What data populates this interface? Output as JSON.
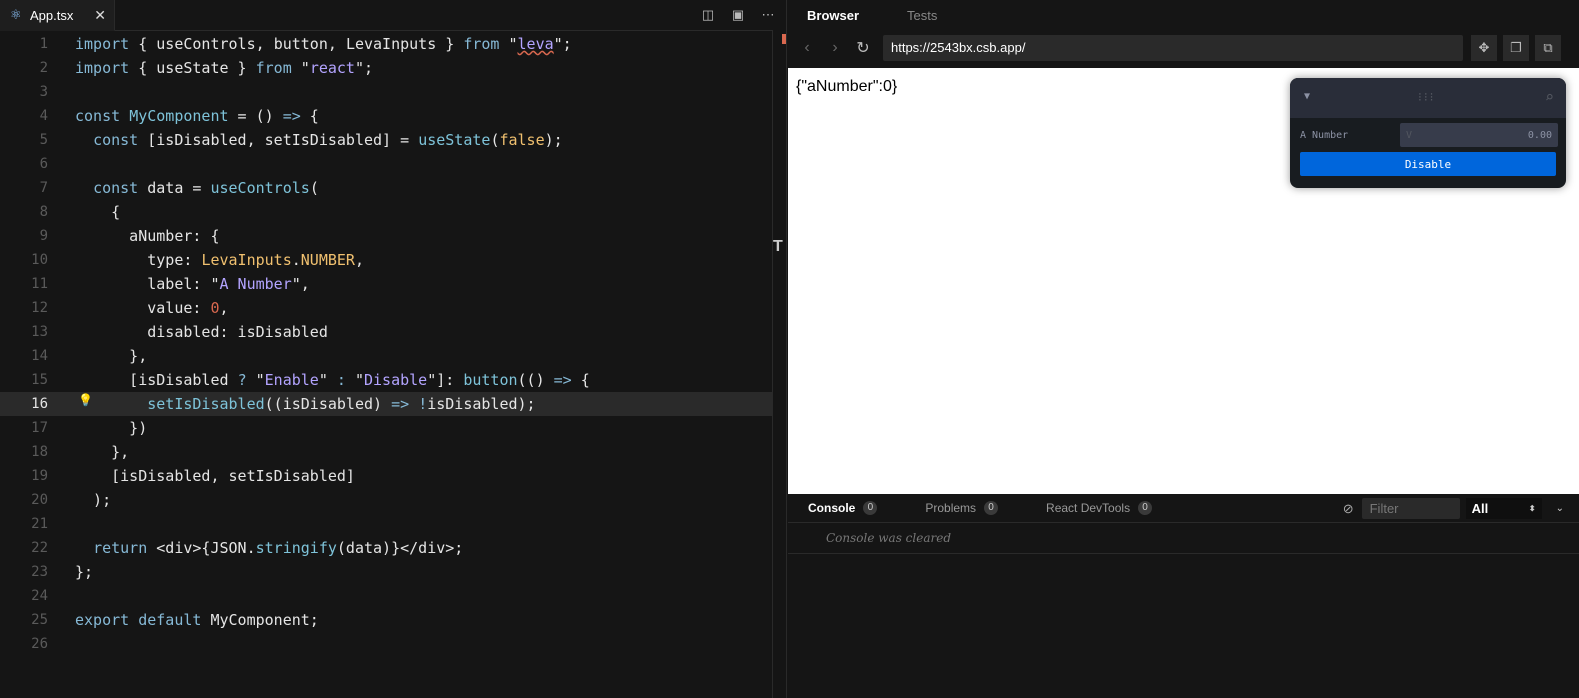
{
  "editor": {
    "tab_name": "App.tsx",
    "tab_close": "✕",
    "icons": [
      "split-icon",
      "preview-icon",
      "more-icon"
    ],
    "lines": [
      {
        "n": "1"
      },
      {
        "n": "2"
      },
      {
        "n": "3"
      },
      {
        "n": "4"
      },
      {
        "n": "5"
      },
      {
        "n": "6"
      },
      {
        "n": "7"
      },
      {
        "n": "8"
      },
      {
        "n": "9"
      },
      {
        "n": "10"
      },
      {
        "n": "11"
      },
      {
        "n": "12"
      },
      {
        "n": "13"
      },
      {
        "n": "14"
      },
      {
        "n": "15"
      },
      {
        "n": "16"
      },
      {
        "n": "17"
      },
      {
        "n": "18"
      },
      {
        "n": "19"
      },
      {
        "n": "20"
      },
      {
        "n": "21"
      },
      {
        "n": "22"
      },
      {
        "n": "23"
      },
      {
        "n": "24"
      },
      {
        "n": "25"
      },
      {
        "n": "26"
      }
    ],
    "code": {
      "l1": [
        "import",
        " { ",
        "useControls",
        ", ",
        "button",
        ", ",
        "LevaInputs",
        " } ",
        "from",
        " \"",
        "leva",
        "\";"
      ],
      "l2": [
        "import",
        " { ",
        "useState",
        " } ",
        "from",
        " \"",
        "react",
        "\";"
      ],
      "l4": [
        "const",
        " ",
        "MyComponent",
        " = () ",
        "=>",
        " {"
      ],
      "l5": [
        "  ",
        "const",
        " [isDisabled, setIsDisabled] = ",
        "useState",
        "(",
        "false",
        ");"
      ],
      "l7": [
        "  ",
        "const",
        " data = ",
        "useControls",
        "("
      ],
      "l8": [
        "    {"
      ],
      "l9": [
        "      aNumber: {"
      ],
      "l10": [
        "        type: ",
        "LevaInputs",
        ".",
        "NUMBER",
        ","
      ],
      "l11": [
        "        label: \"",
        "A Number",
        "\","
      ],
      "l12": [
        "        value: ",
        "0",
        ","
      ],
      "l13": [
        "        disabled: isDisabled"
      ],
      "l14": [
        "      },"
      ],
      "l15": [
        "      [isDisabled ",
        "?",
        " \"",
        "Enable",
        "\" ",
        ":",
        " \"",
        "Disable",
        "\"]: ",
        "button",
        "(() ",
        "=>",
        " {"
      ],
      "l16": [
        "        ",
        "setIsDisabled",
        "((isDisabled) ",
        "=>",
        " ",
        "!",
        "isDisabled);"
      ],
      "l17": [
        "      })"
      ],
      "l18": [
        "    },"
      ],
      "l19": [
        "    [isDisabled, setIsDisabled]"
      ],
      "l20": [
        "  );"
      ],
      "l22": [
        "  ",
        "return",
        " <div>{JSON.",
        "stringify",
        "(data)}</div>;"
      ],
      "l23": [
        "};"
      ],
      "l25": [
        "export",
        " ",
        "default",
        " MyComponent;"
      ]
    }
  },
  "browser": {
    "tabs": {
      "browser": "Browser",
      "tests": "Tests"
    },
    "nav": {
      "back": "‹",
      "forward": "›",
      "refresh": "↻"
    },
    "url": "https://2543bx.csb.app/",
    "output": "{\"aNumber\":0}",
    "leva": {
      "drag": "⁝⁝⁝",
      "field_label": "A Number",
      "field_prefix": "V",
      "field_value": "0.00",
      "button_label": "Disable"
    }
  },
  "console": {
    "tabs": [
      {
        "label": "Console",
        "count": "0"
      },
      {
        "label": "Problems",
        "count": "0"
      },
      {
        "label": "React DevTools",
        "count": "0"
      }
    ],
    "filter_placeholder": "Filter",
    "level": "All",
    "message": "Console was cleared"
  }
}
